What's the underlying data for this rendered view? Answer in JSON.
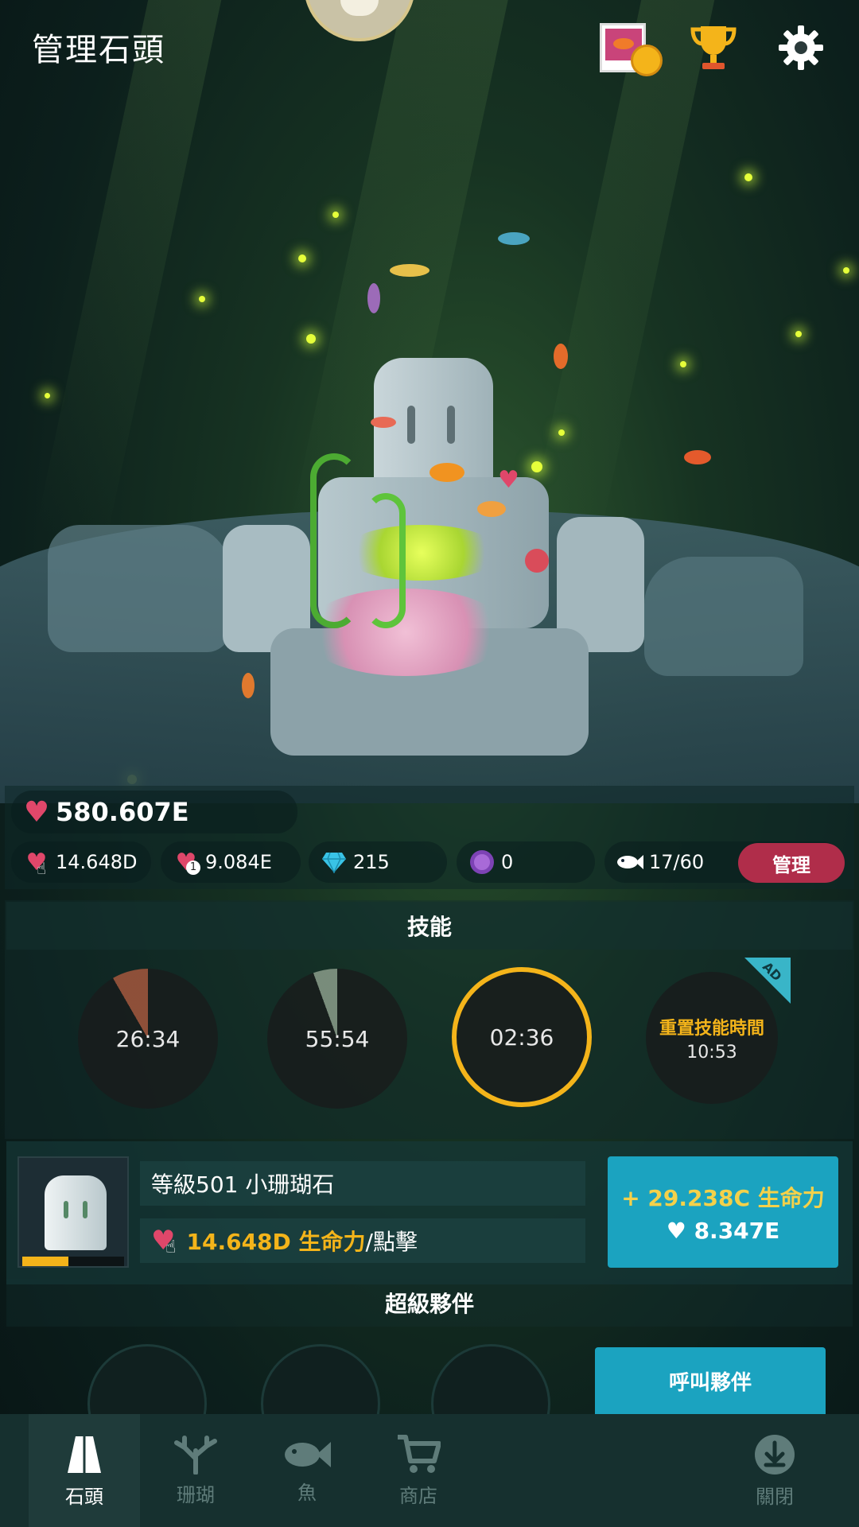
{
  "header": {
    "title": "管理石頭",
    "icons": [
      "fish-album-icon",
      "trophy-icon",
      "gear-icon"
    ]
  },
  "stats": {
    "vitality": "580.607E",
    "per_tap": "14.648D",
    "per_time": "9.084E",
    "gems": "215",
    "orbs": "0",
    "fish_count": "17/60",
    "manage_label": "管理"
  },
  "skills": {
    "section_title": "技能",
    "items": [
      {
        "timer": "26:34",
        "ready": false
      },
      {
        "timer": "55:54",
        "ready": false
      },
      {
        "timer": "02:36",
        "ready": true
      },
      {
        "label": "重置技能時間",
        "timer": "10:53",
        "badge": "AD"
      }
    ]
  },
  "stone": {
    "level_name": "等級501 小珊瑚石",
    "tap_value": "14.648D 生命力",
    "tap_suffix": "/點擊",
    "upgrade_gain": "+ 29.238C 生命力",
    "upgrade_cost": "8.347E",
    "progress": 0.45
  },
  "partners": {
    "section_title": "超級夥伴",
    "call_label": "呼叫夥伴"
  },
  "nav": {
    "items": [
      {
        "label": "石頭",
        "active": true
      },
      {
        "label": "珊瑚",
        "active": false
      },
      {
        "label": "魚",
        "active": false
      },
      {
        "label": "商店",
        "active": false
      },
      {
        "label": "關閉",
        "active": false
      }
    ]
  },
  "colors": {
    "accent_gold": "#f4b41a",
    "heart_pink": "#e0476a",
    "button_blue": "#1ba3c0",
    "manage_red": "#b02d4a"
  }
}
